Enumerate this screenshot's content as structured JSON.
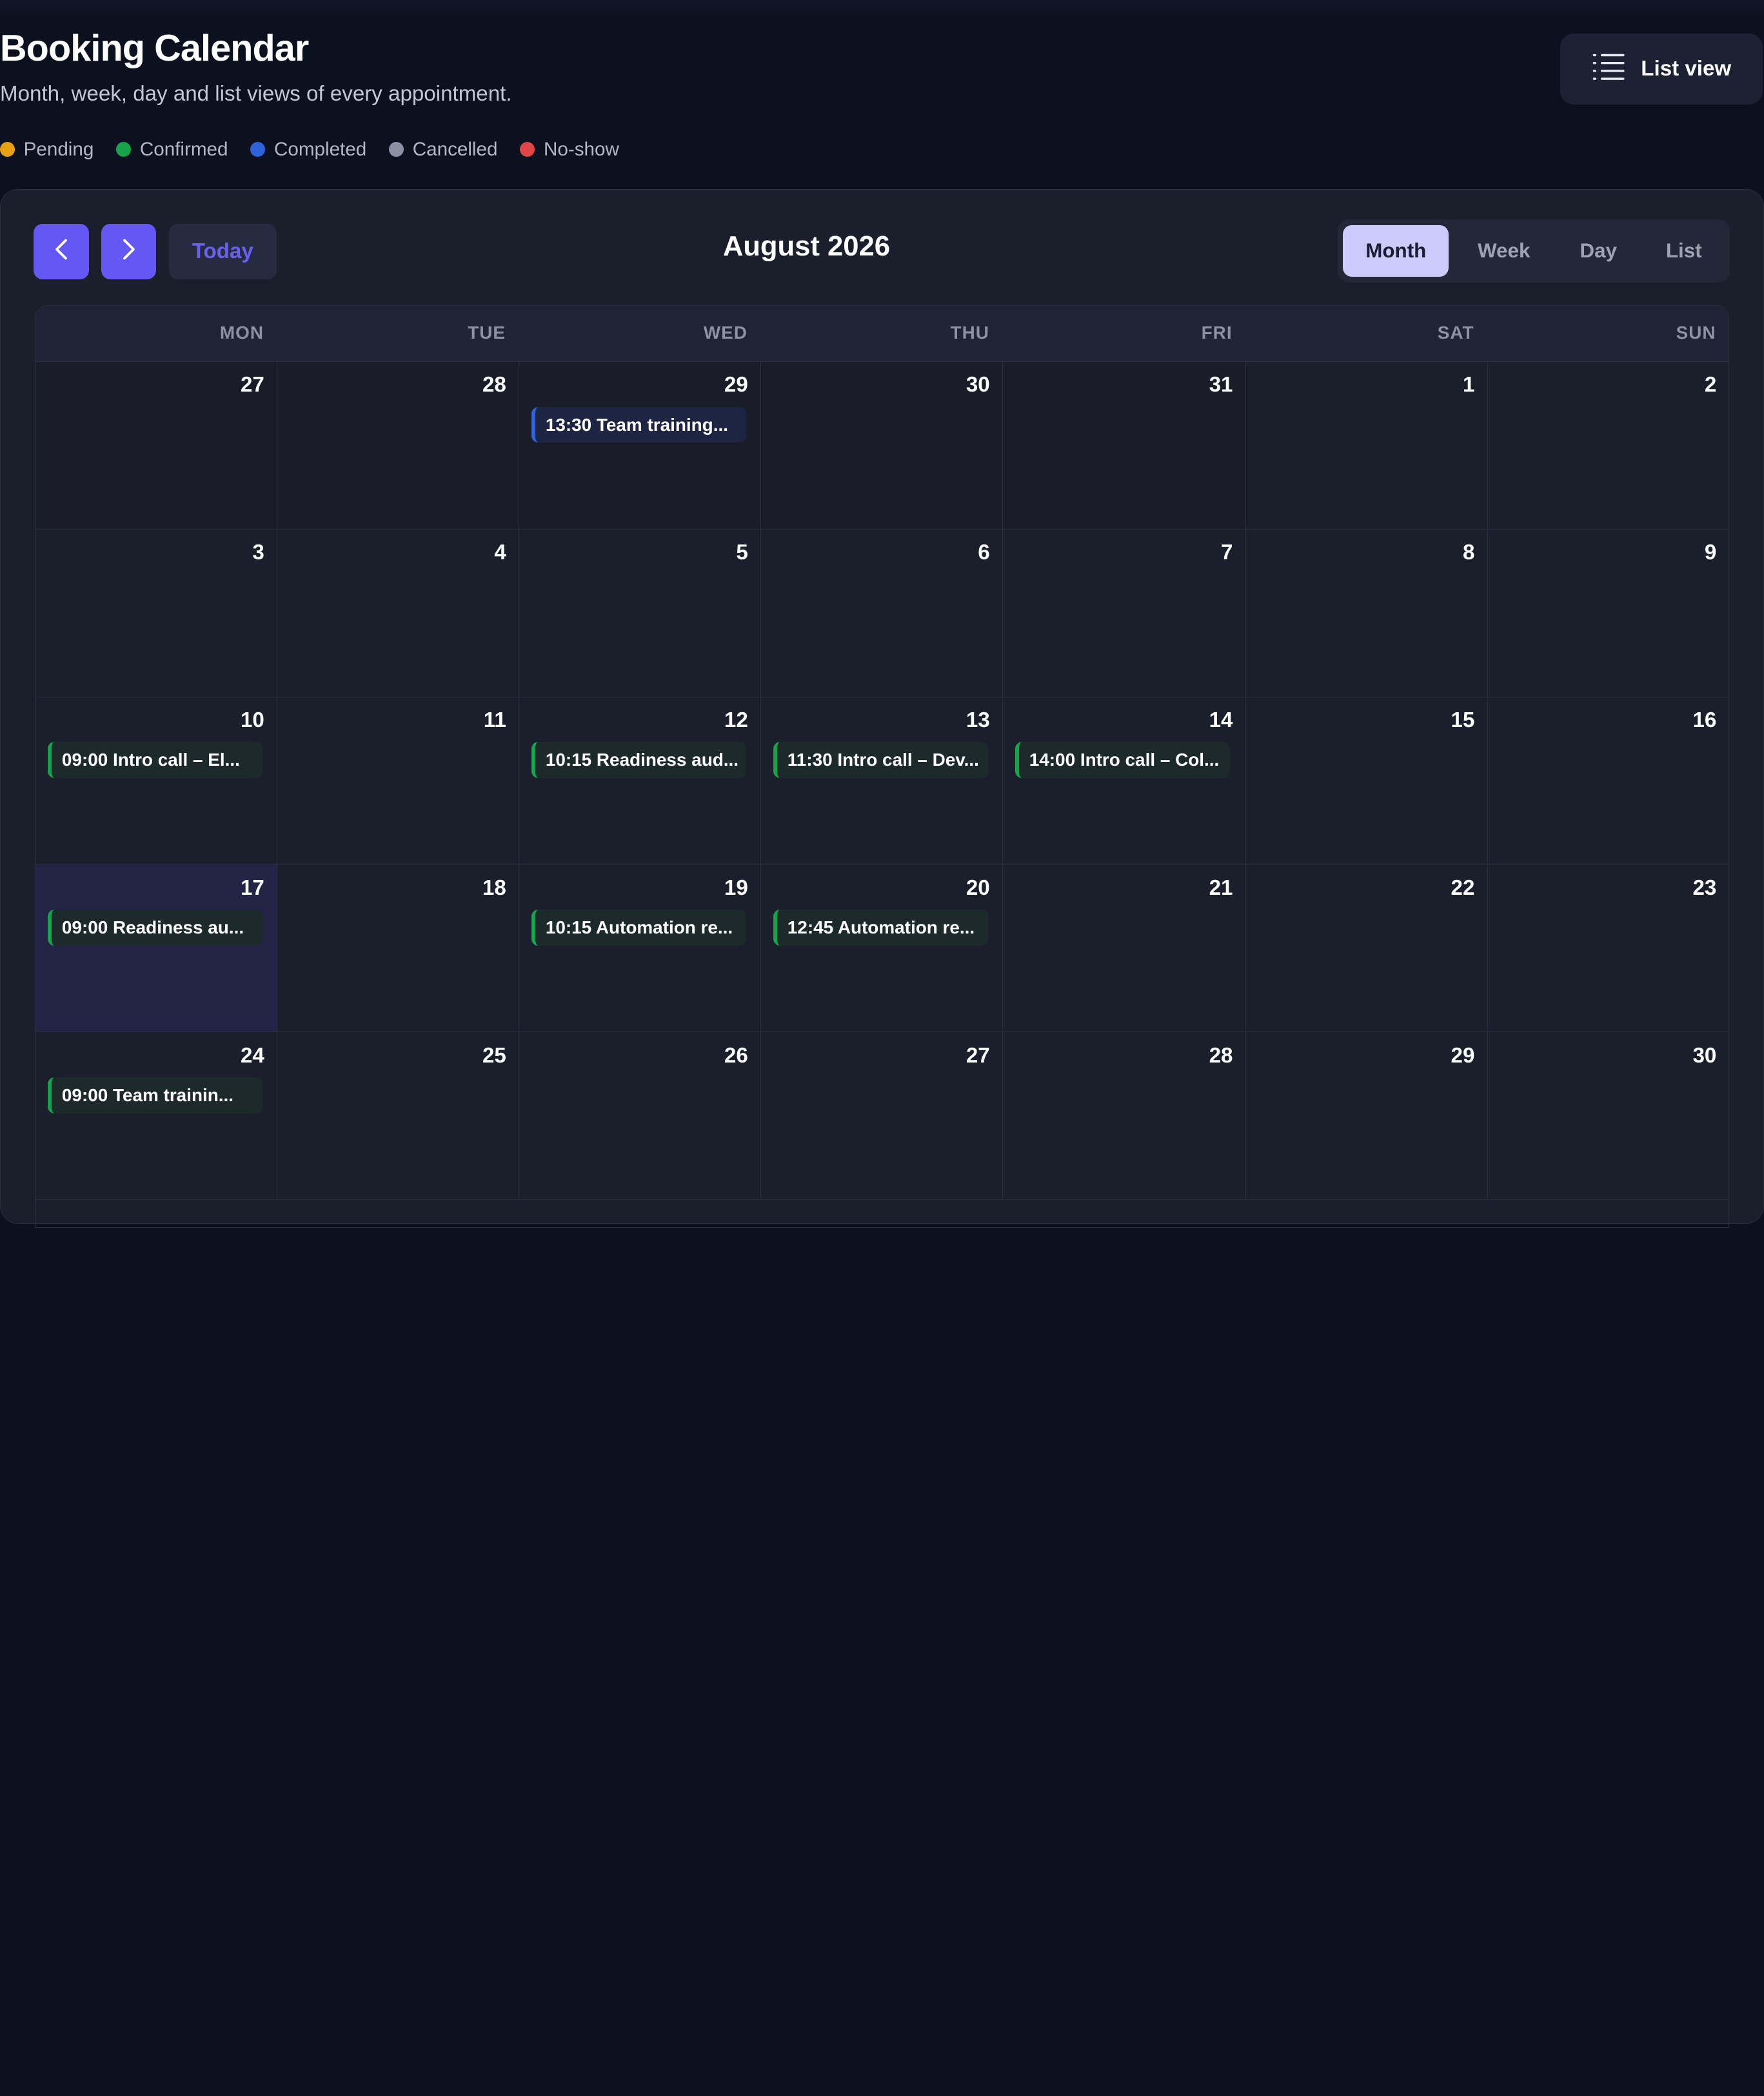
{
  "header": {
    "title": "Booking Calendar",
    "subtitle": "Month, week, day and list views of every appointment.",
    "list_view_label": "List view",
    "list_view_icon": "list-icon"
  },
  "legend": [
    {
      "label": "Pending",
      "color": "#e5a112"
    },
    {
      "label": "Confirmed",
      "color": "#16a34a"
    },
    {
      "label": "Completed",
      "color": "#2f63d9"
    },
    {
      "label": "Cancelled",
      "color": "#8d8fa6"
    },
    {
      "label": "No-show",
      "color": "#e04646"
    }
  ],
  "toolbar": {
    "prev_icon": "chevron-left-icon",
    "next_icon": "chevron-right-icon",
    "today_label": "Today",
    "month_title": "August 2026",
    "views": [
      "Month",
      "Week",
      "Day",
      "List"
    ],
    "active_view": "Month"
  },
  "colors": {
    "accent": "#6458f4",
    "confirmed": "#16a34a",
    "completed": "#2f63d9",
    "today_cell": "#222345"
  },
  "weekdays": [
    "MON",
    "TUE",
    "WED",
    "THU",
    "FRI",
    "SAT",
    "SUN"
  ],
  "weeks": [
    [
      {
        "day": "27",
        "other": true
      },
      {
        "day": "28",
        "other": true
      },
      {
        "day": "29",
        "other": true,
        "event": "13:30 Team training...",
        "status": "completed"
      },
      {
        "day": "30",
        "other": true
      },
      {
        "day": "31",
        "other": true
      },
      {
        "day": "1"
      },
      {
        "day": "2"
      }
    ],
    [
      {
        "day": "3"
      },
      {
        "day": "4"
      },
      {
        "day": "5"
      },
      {
        "day": "6"
      },
      {
        "day": "7"
      },
      {
        "day": "8"
      },
      {
        "day": "9"
      }
    ],
    [
      {
        "day": "10",
        "event": "09:00 Intro call – El...",
        "status": "confirmed"
      },
      {
        "day": "11"
      },
      {
        "day": "12",
        "event": "10:15 Readiness aud...",
        "status": "confirmed"
      },
      {
        "day": "13",
        "event": "11:30 Intro call – Dev...",
        "status": "confirmed"
      },
      {
        "day": "14",
        "event": "14:00 Intro call – Col...",
        "status": "confirmed"
      },
      {
        "day": "15"
      },
      {
        "day": "16"
      }
    ],
    [
      {
        "day": "17",
        "today": true,
        "event": "09:00 Readiness au...",
        "status": "confirmed"
      },
      {
        "day": "18"
      },
      {
        "day": "19",
        "event": "10:15 Automation re...",
        "status": "confirmed"
      },
      {
        "day": "20",
        "event": "12:45 Automation re...",
        "status": "confirmed"
      },
      {
        "day": "21"
      },
      {
        "day": "22"
      },
      {
        "day": "23"
      }
    ],
    [
      {
        "day": "24",
        "event": "09:00 Team trainin...",
        "status": "confirmed"
      },
      {
        "day": "25"
      },
      {
        "day": "26"
      },
      {
        "day": "27"
      },
      {
        "day": "28"
      },
      {
        "day": "29"
      },
      {
        "day": "30"
      }
    ]
  ]
}
